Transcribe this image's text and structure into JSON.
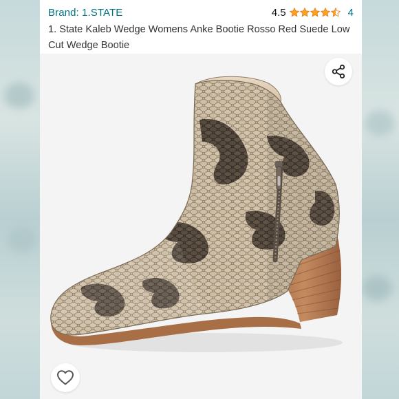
{
  "brand_line": "Brand: 1.STATE",
  "rating": {
    "score": "4.5",
    "stars": 4.5,
    "max_stars": 5,
    "review_count": "4"
  },
  "title": "1. State Kaleb Wedge Womens Anke Bootie Rosso Red Suede Low Cut Wedge Bootie",
  "icons": {
    "share": "share-icon",
    "favorite": "heart-icon",
    "star": "star-icon"
  },
  "colors": {
    "link": "#007185",
    "star": "#FFA41C",
    "background": "#cfdfe0"
  }
}
